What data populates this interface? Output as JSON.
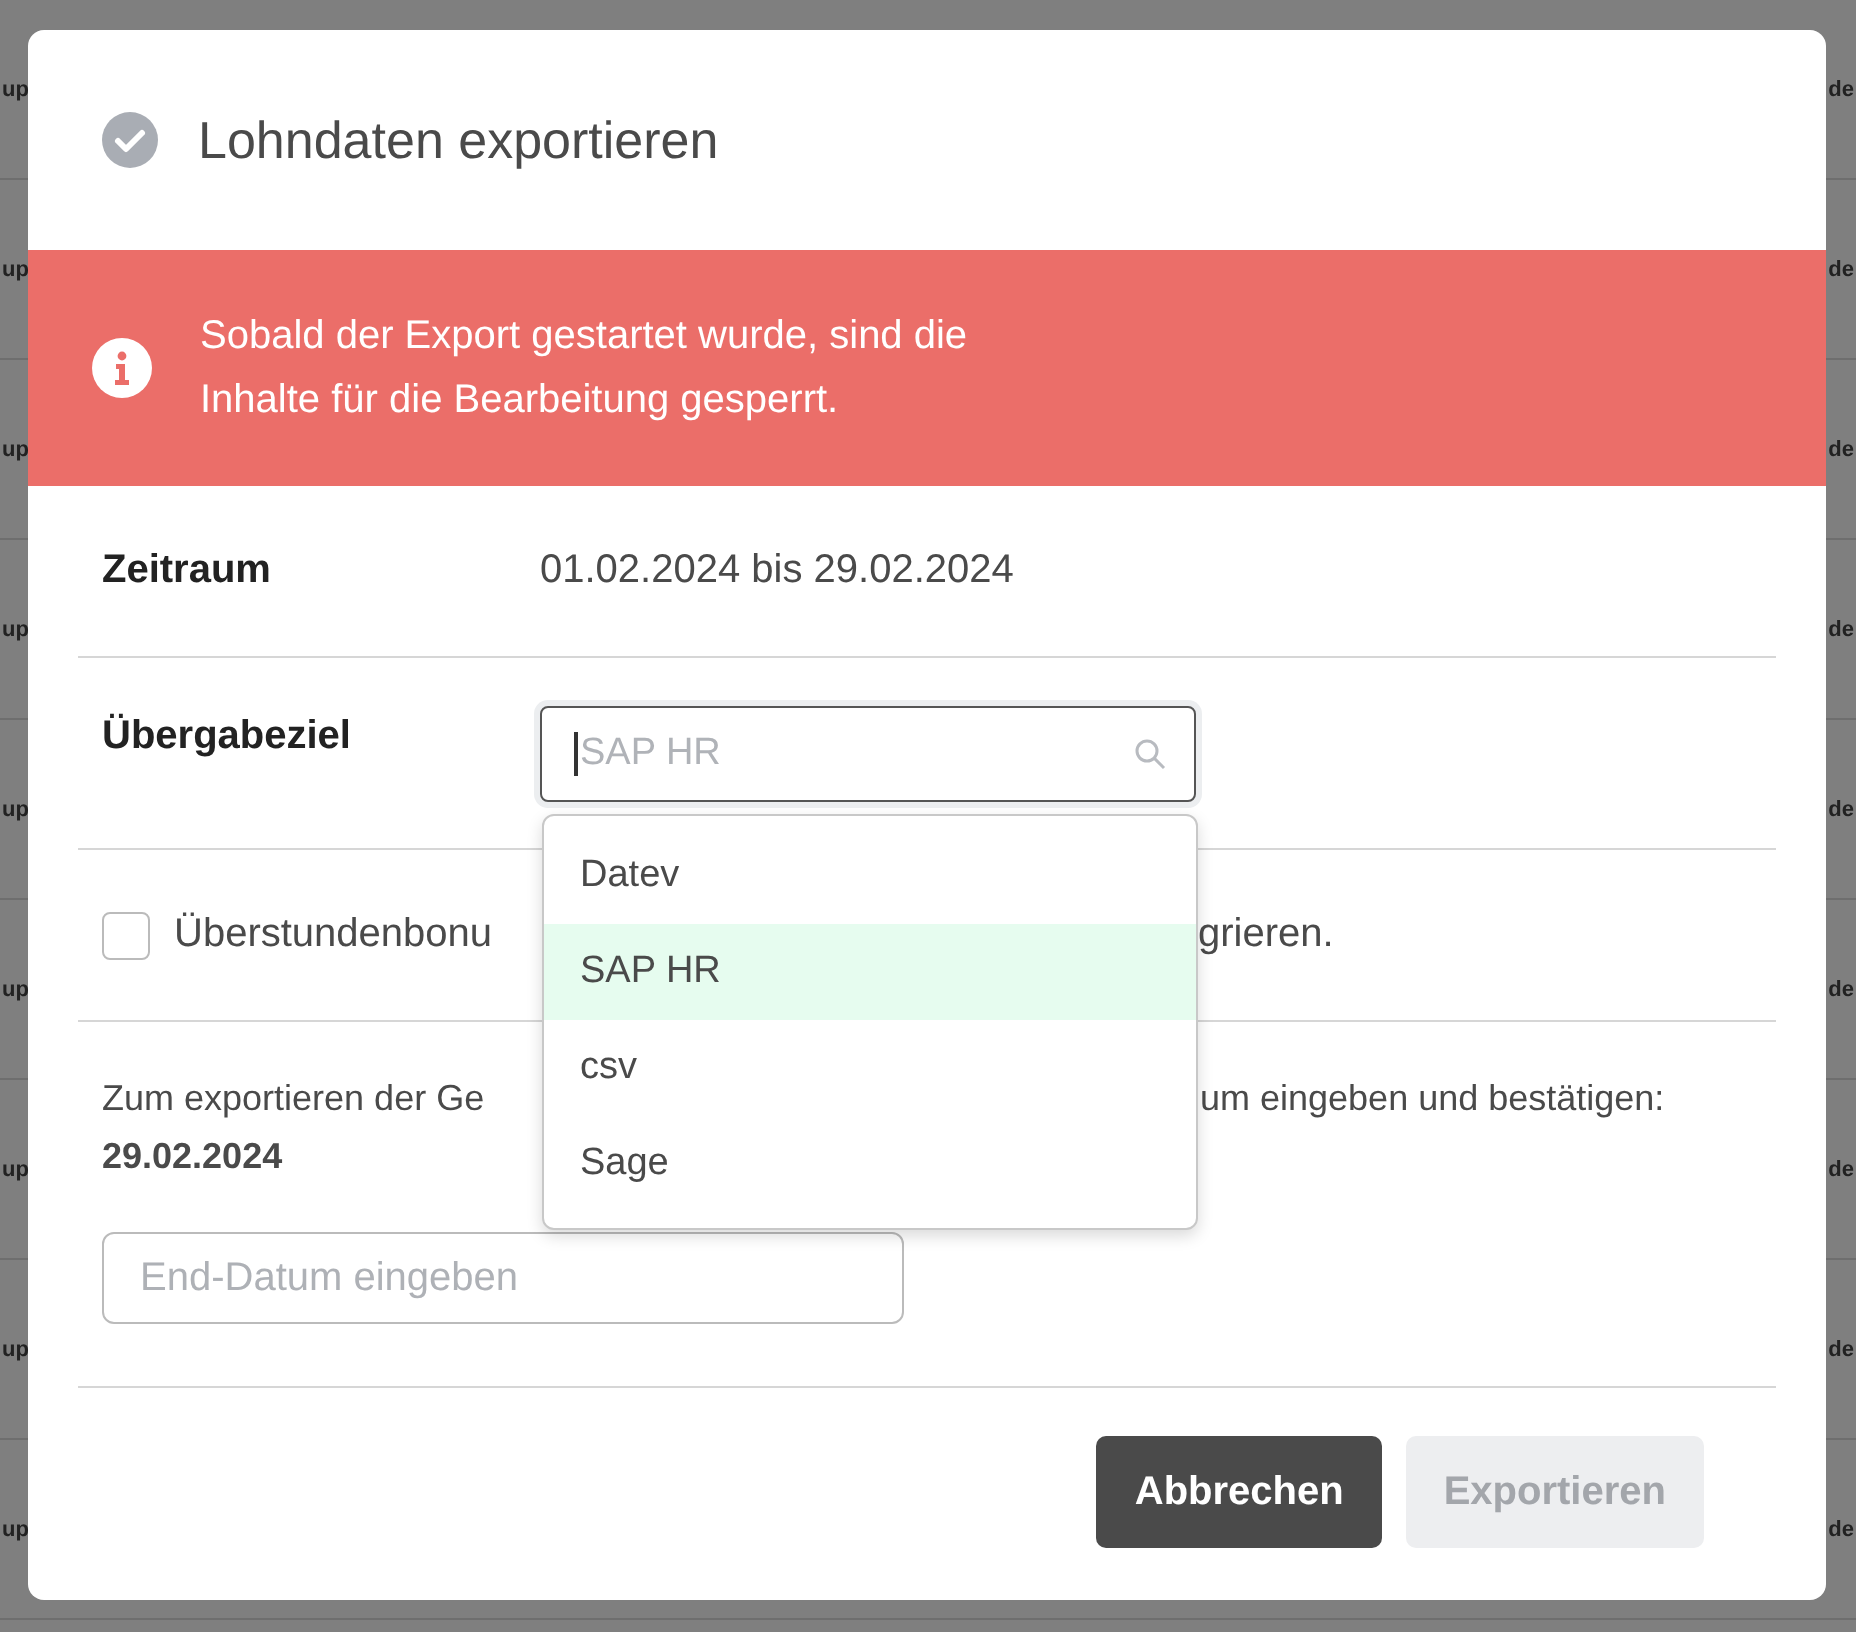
{
  "background": {
    "rows": [
      {
        "column_1": "up",
        "column_2": "de"
      },
      {
        "column_1": "up",
        "column_2": "de"
      },
      {
        "column_1": "up",
        "column_2": "de"
      },
      {
        "column_1": "up",
        "column_2": "de"
      },
      {
        "column_1": "up",
        "column_2": "de"
      },
      {
        "column_1": "up",
        "column_2": "de"
      },
      {
        "column_1": "up",
        "column_2": "de"
      },
      {
        "column_1": "up",
        "column_2": "de"
      },
      {
        "column_1": "up",
        "column_2": "de"
      }
    ]
  },
  "dialog": {
    "title": "Lohndaten exportieren",
    "alert": "Sobald der Export gestartet wurde, sind die\nInhalte für die Bearbeitung gesperrt.",
    "period": {
      "label": "Zeitraum",
      "value": "01.02.2024 bis 29.02.2024"
    },
    "target": {
      "label": "Übergabeziel",
      "placeholder": "SAP HR",
      "expanded": true,
      "options": [
        {
          "label": "Datev",
          "selected": false
        },
        {
          "label": "SAP HR",
          "selected": true
        },
        {
          "label": "csv",
          "selected": false
        },
        {
          "label": "Sage",
          "selected": false
        }
      ]
    },
    "checkbox": {
      "checked": false,
      "label_start": "Überstundenbonu",
      "label_end": "grieren."
    },
    "instruction": {
      "text_start": "Zum exportieren der Ge",
      "text_end": "um eingeben und bestätigen:",
      "date": "29.02.2024"
    },
    "date_field": {
      "placeholder": "End-Datum eingeben"
    },
    "buttons": [
      {
        "label": "Abbrechen",
        "kind": "secondary",
        "disabled": false
      },
      {
        "label": "Exportieren",
        "kind": "primary",
        "disabled": true
      }
    ]
  }
}
